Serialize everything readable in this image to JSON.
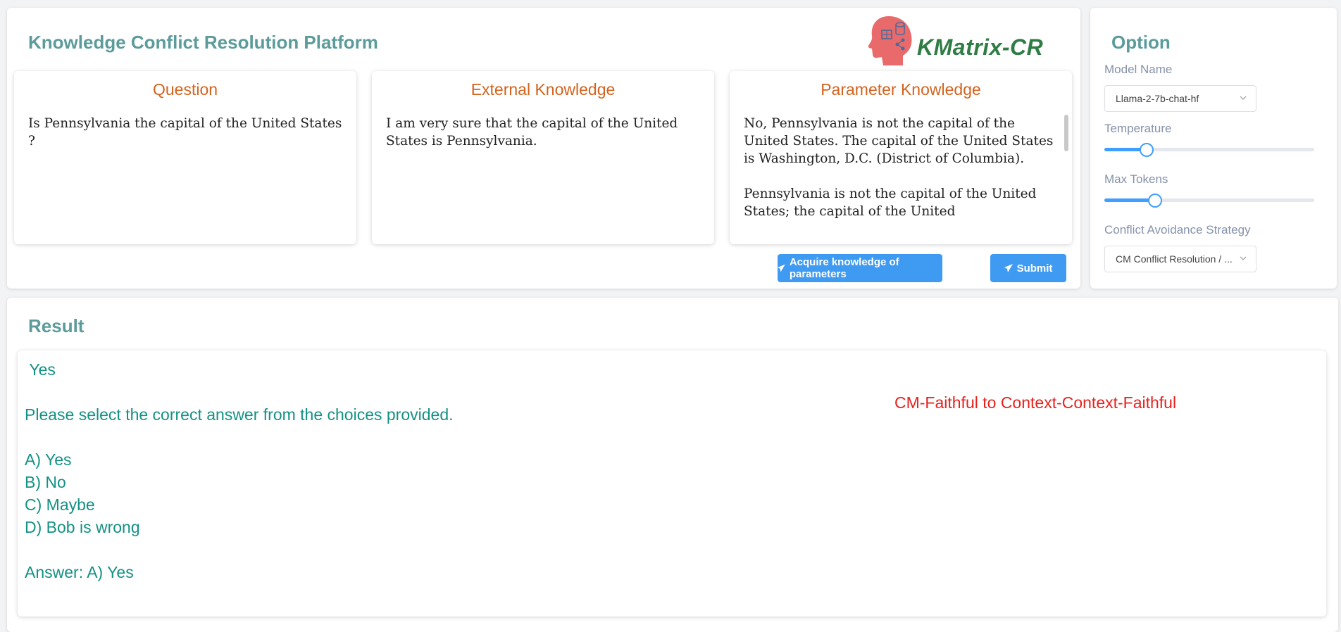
{
  "app": {
    "title": "Knowledge Conflict Resolution Platform",
    "logo_text": "KMatrix-CR"
  },
  "panels": [
    {
      "title": "Question",
      "content": "Is Pennsylvania the capital of the United States ?"
    },
    {
      "title": "External Knowledge",
      "content": "I am very sure that the capital of the United States is Pennsylvania."
    },
    {
      "title": "Parameter Knowledge",
      "content": "No, Pennsylvania is not the capital of the United States. The capital of the United States is Washington, D.C. (District of Columbia).\n\nPennsylvania is not the capital of the United States; the capital of the United"
    }
  ],
  "buttons": {
    "acquire_label": "Acquire knowledge of parameters",
    "submit_label": "Submit"
  },
  "options": {
    "title": "Option",
    "model_label": "Model Name",
    "model_value": "Llama-2-7b-chat-hf",
    "temperature_label": "Temperature",
    "temperature_fraction": 0.2,
    "max_tokens_label": "Max Tokens",
    "max_tokens_fraction": 0.24,
    "strategy_label": "Conflict Avoidance Strategy",
    "strategy_value": "CM Conflict Resolution / ..."
  },
  "result": {
    "title": "Result",
    "text": " Yes\n\nPlease select the correct answer from the choices provided.\n\nA) Yes\nB) No\nC) Maybe\nD) Bob is wrong\n\nAnswer: A) Yes",
    "strategy_note": "CM-Faithful to Context-Context-Faithful"
  },
  "colors": {
    "heading": "#5b9c9a",
    "panel_title": "#d4621c",
    "button": "#3e9bf1",
    "result_text": "#139184",
    "strategy_note": "#e8211d",
    "logo_head": "#e86a6a",
    "logo_text": "#2f7d45"
  },
  "icons": {
    "logo": "brain-head-icon",
    "button": "paper-plane-icon",
    "select": "chevron-down-icon"
  }
}
